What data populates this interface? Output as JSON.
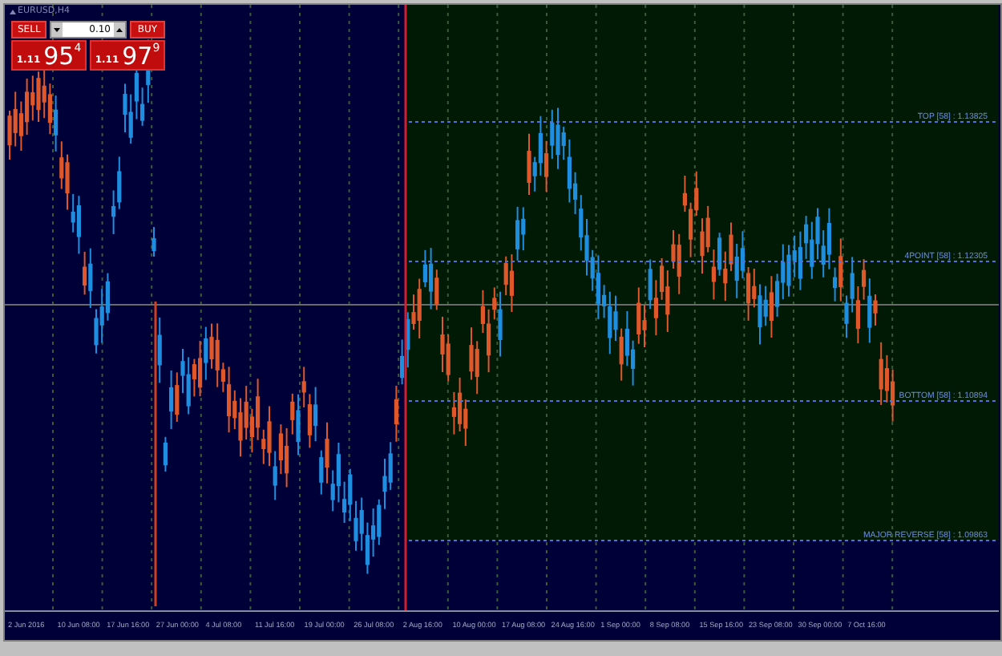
{
  "chart": {
    "symbol": "EURUSD,H4",
    "trade_panel": {
      "sell_label": "SELL",
      "buy_label": "BUY",
      "lot": "0.10",
      "sell_price": {
        "prefix": "1.11",
        "big": "95",
        "sup": "4"
      },
      "buy_price": {
        "prefix": "1.11",
        "big": "97",
        "sup": "9"
      }
    },
    "levels": [
      {
        "label": "TOP [58] : 1.13825"
      },
      {
        "label": "4POINT [58] : 1.12305"
      },
      {
        "label": "BOTTOM [58] : 1.10894"
      },
      {
        "label": "MAJOR REVERSE [58] : 1.09863"
      }
    ],
    "time_axis": [
      "2 Jun 2016",
      "10 Jun 08:00",
      "17 Jun 16:00",
      "27 Jun 00:00",
      "4 Jul 08:00",
      "11 Jul 16:00",
      "19 Jul 00:00",
      "26 Jul 08:00",
      "2 Aug 16:00",
      "10 Aug 00:00",
      "17 Aug 08:00",
      "24 Aug 16:00",
      "1 Sep 00:00",
      "8 Sep 08:00",
      "15 Sep 16:00",
      "23 Sep 08:00",
      "30 Sep 00:00",
      "7 Oct 16:00"
    ]
  }
}
